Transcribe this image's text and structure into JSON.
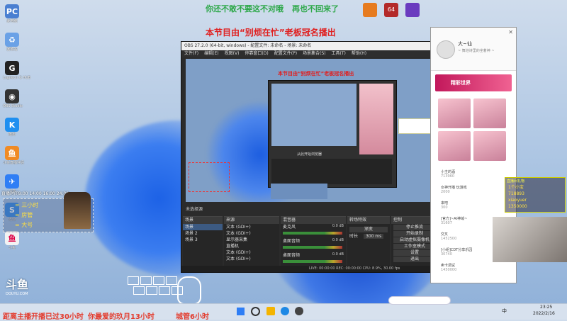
{
  "banner": {
    "line1_left": "你还不敢不要这不对哦",
    "line1_right": "再也不回来了",
    "line2": "本节目由“别烦在忙”老板冠名播出"
  },
  "desktop_icons": [
    {
      "label": "此电脑",
      "color": "#4a7fd1",
      "glyph": "PC"
    },
    {
      "label": "回收站",
      "color": "#6aa1e6",
      "glyph": "♻"
    },
    {
      "label": "Logitech G HUB",
      "color": "#222222",
      "glyph": "G"
    },
    {
      "label": "OBS Studio",
      "color": "#333333",
      "glyph": "◉"
    },
    {
      "label": "酷狗",
      "color": "#1f8ff0",
      "glyph": "K"
    },
    {
      "label": "斗鱼直播伴侣",
      "color": "#f08b25",
      "glyph": "鱼"
    },
    {
      "label": "飞书",
      "color": "#2f7ef5",
      "glyph": "✈"
    },
    {
      "label": "迅游",
      "color": "#3a8ee8",
      "glyph": "S"
    },
    {
      "label": "斗鱼",
      "color": "#f2f2f2",
      "glyph": "鱼"
    }
  ],
  "schedule": {
    "header": "直播时间9:00 14:00 16:00 24:00",
    "items": [
      "= 三小时",
      "= 房管",
      "= 大号"
    ]
  },
  "obs": {
    "title": "OBS 27.2.0 (64-bit, windows) - 配置文件: 未命名 - 场景: 未命名",
    "menu": [
      "文件(F)",
      "编辑(E)",
      "视图(V)",
      "停靠窗口(D)",
      "配置文件(P)",
      "场景集合(S)",
      "工具(T)",
      "帮助(H)"
    ],
    "preview_banner": "本节目由“别烦在忙”老板冠名播出",
    "nested_title": "从此开始浏览器",
    "scenes_header": "场景",
    "scenes": [
      "场景",
      "场景 2",
      "场景 3"
    ],
    "sources_header": "来源",
    "sources": [
      "文本 (GDI+)",
      "文本 (GDI+)",
      "显示器采集",
      "直播机",
      "文本 (GDI+)",
      "文本 (GDI+)",
      "文本 (GDI+)",
      "文本 (GDI+)"
    ],
    "mixer_header": "混音器",
    "mixer": [
      {
        "name": "麦克风",
        "db": "0.0 dB"
      },
      {
        "name": "桌面音频",
        "db": "0.0 dB"
      },
      {
        "name": "桌面音频",
        "db": "0.0 dB"
      }
    ],
    "transitions_header": "转场特效",
    "transition_value": "渐变",
    "duration_label": "时长",
    "duration_value": "300 ms",
    "controls_header": "控制",
    "controls": [
      "停止推流",
      "开始录制",
      "启动虚拟摄像机",
      "工作室模式",
      "设置",
      "退出"
    ],
    "status": "LIVE: 00:00:00   REC: 00:00:00   CPU: 8.9%, 30.00 fps",
    "preview_label": "未选择源"
  },
  "yy": {
    "name": "大~仙",
    "subtitle": "~ 舞池诗里的坐着神 ~",
    "channel_title": "精彩世界",
    "list": [
      {
        "title": "小主的酒",
        "count": "713960"
      },
      {
        "title": "女神开播 玩游戏",
        "count": "2000"
      },
      {
        "title": "来吧",
        "count": "300"
      },
      {
        "title": "[官方]~AI神域~",
        "count": "31607"
      },
      {
        "title": "交叉",
        "count": "1452500"
      },
      {
        "title": "[小组]CDT分享乐园",
        "count": "30740"
      },
      {
        "title": "卖卡调试",
        "count": "1450000"
      }
    ]
  },
  "overlay": {
    "gift_title": "直播间礼物",
    "lines": [
      "1个小宝",
      "718893",
      "xiaoyuer",
      "1350000"
    ]
  },
  "taskbar": {
    "ticker": [
      "距离主播开播已过30小时",
      "你最爱的玖月13小时",
      "城管6小时"
    ],
    "time": "23:25",
    "date": "2022/2/16",
    "lang": "中"
  },
  "colors": {
    "banner_green": "#2ea84a",
    "banner_red": "#e02020",
    "ticker_red": "#e33d2f",
    "obs_bg": "#2b2b2b"
  }
}
